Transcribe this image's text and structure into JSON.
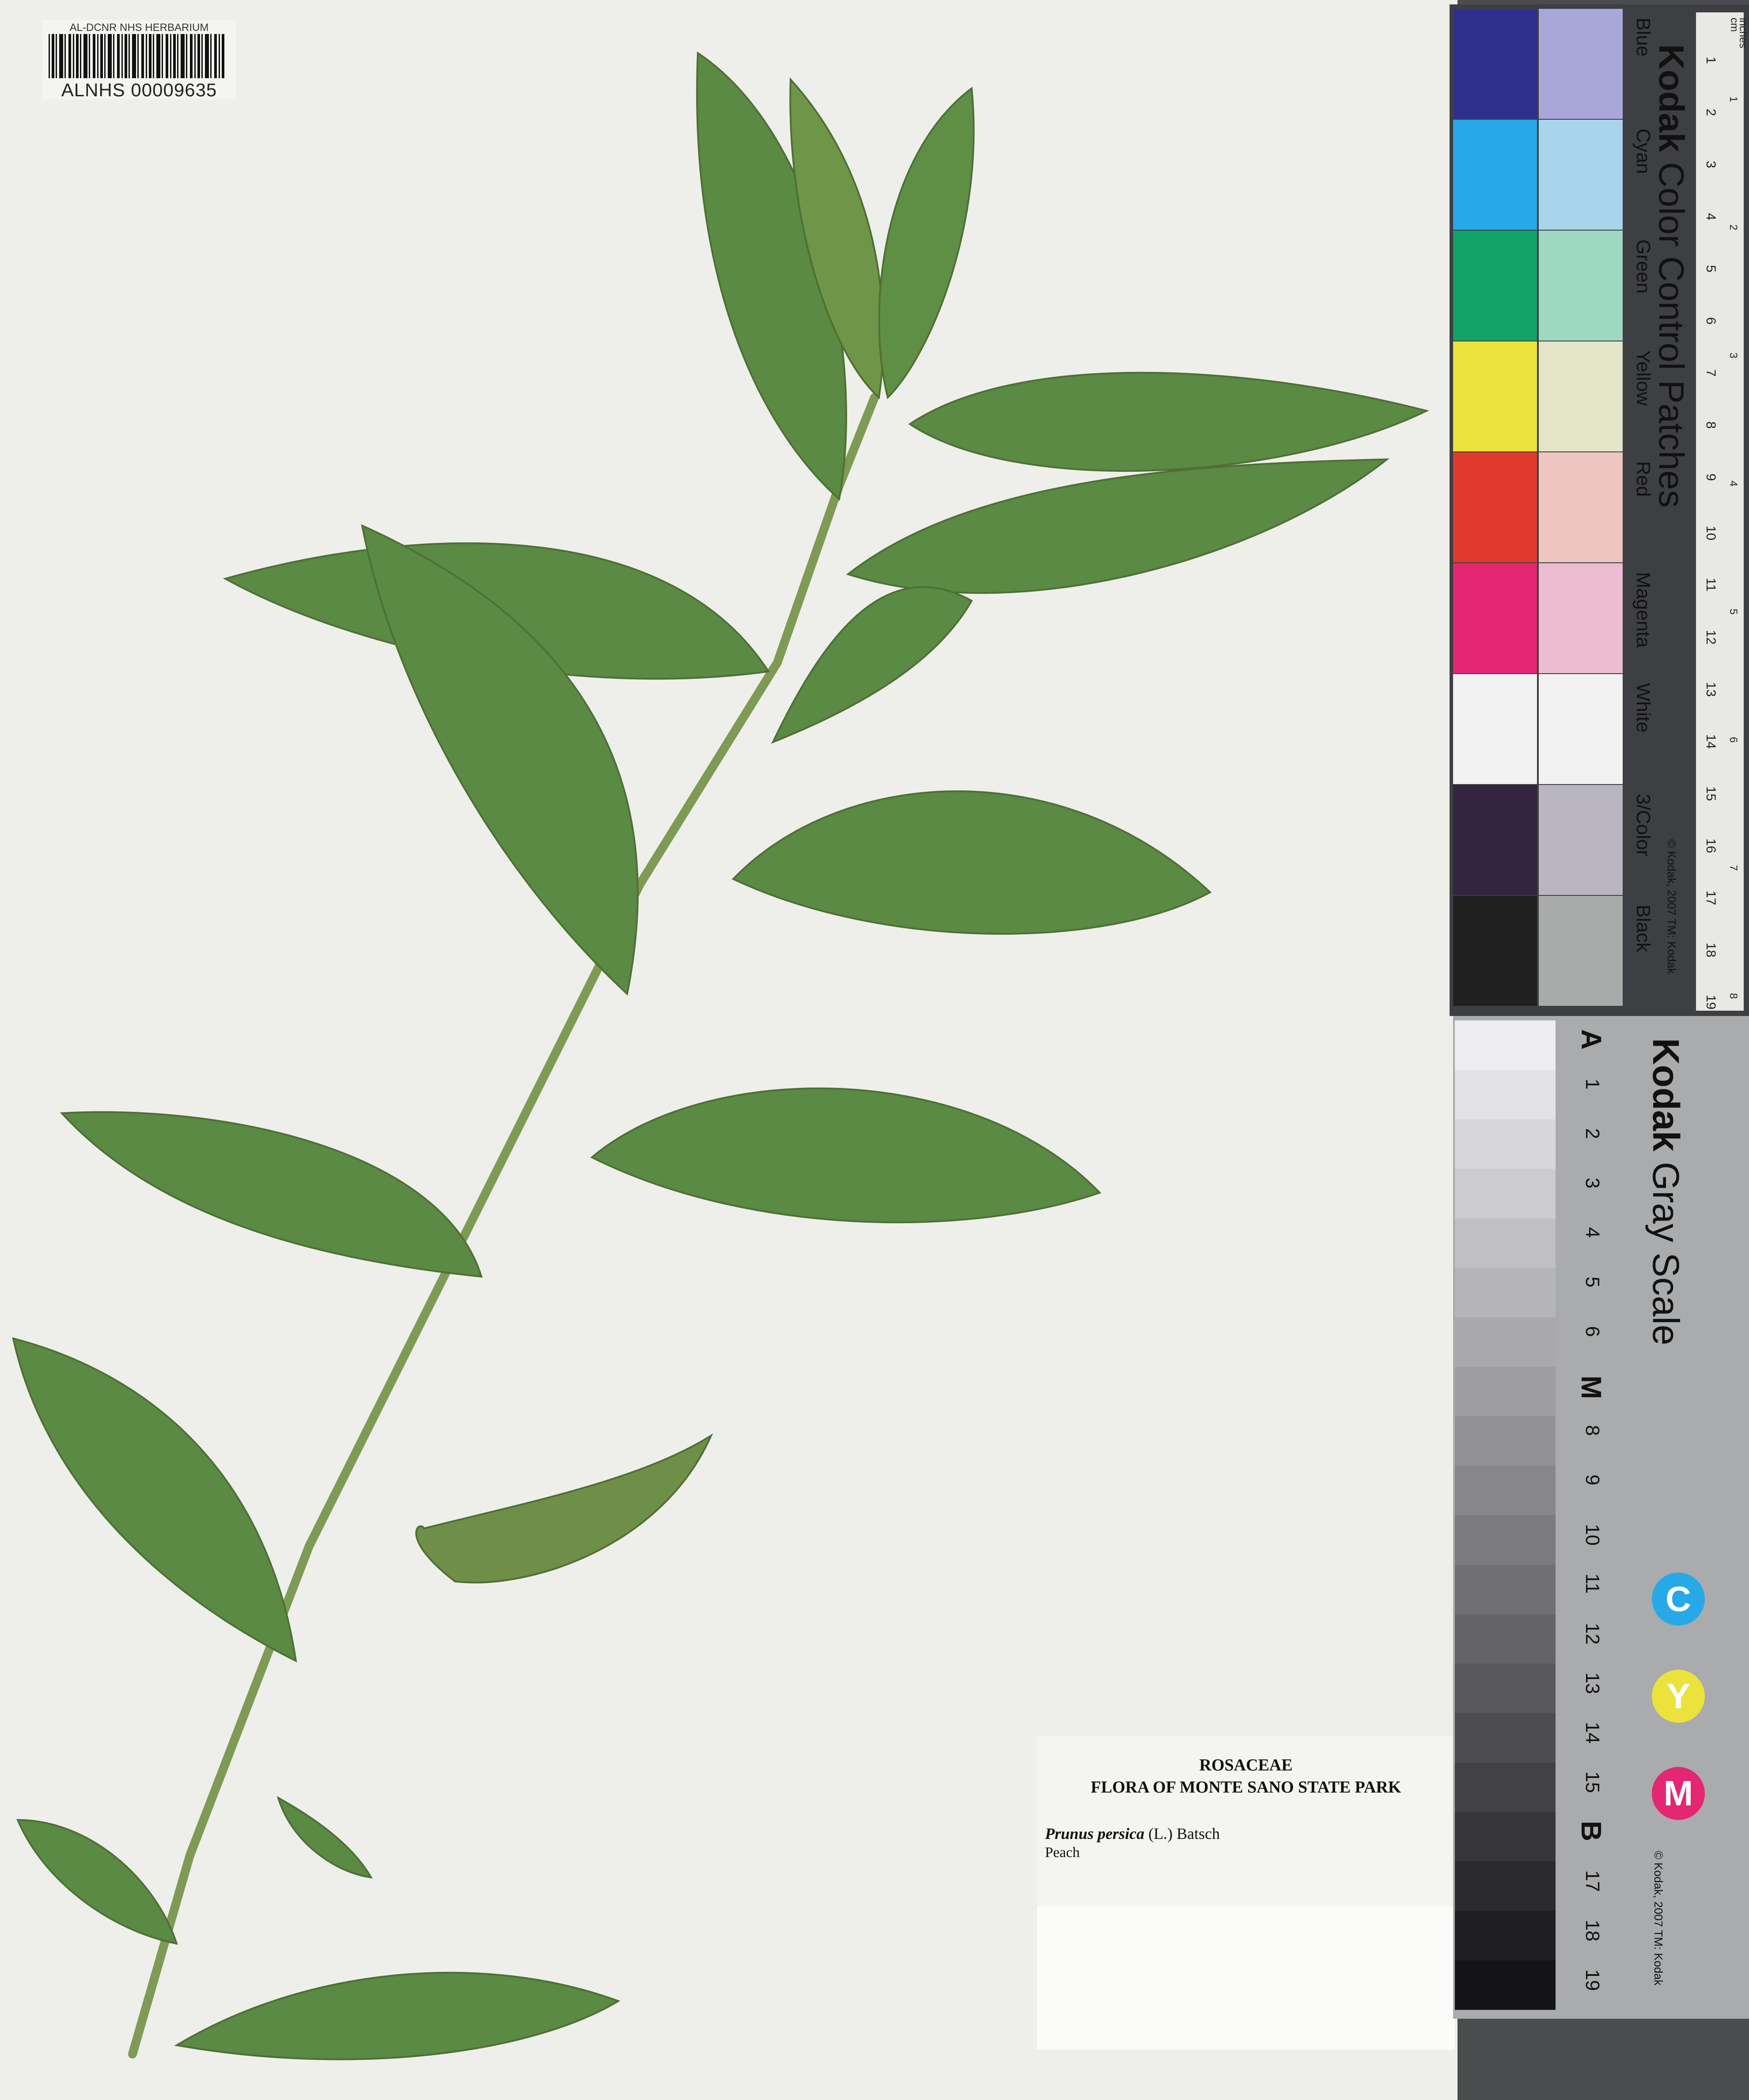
{
  "barcode": {
    "institution": "AL-DCNR NHS HERBARIUM",
    "number": "ALNHS 00009635"
  },
  "label": {
    "family": "ROSACEAE",
    "flora": "FLORA OF MONTE SANO STATE PARK",
    "taxon_genus_species": "Prunus persica",
    "taxon_authority": "(L.) Batsch",
    "common_name": "Peach"
  },
  "color_card": {
    "brand": "Kodak",
    "title": "Color Control Patches",
    "copyright": "© Kodak, 2007 TM: Kodak",
    "ruler_units": [
      "cm",
      "inches"
    ],
    "ruler_cm": [
      "1",
      "2",
      "3",
      "4",
      "5",
      "6",
      "7",
      "8",
      "9",
      "10",
      "11",
      "12",
      "13",
      "14",
      "15",
      "16",
      "17",
      "18",
      "19"
    ],
    "ruler_inches": [
      "1",
      "2",
      "3",
      "4",
      "5",
      "6",
      "7",
      "8"
    ],
    "patches": [
      {
        "label": "Blue",
        "color": "#2f2f8e",
        "tint": "#a9a7da"
      },
      {
        "label": "Cyan",
        "color": "#27a9e8",
        "tint": "#a8d5ec"
      },
      {
        "label": "Green",
        "color": "#14a268",
        "tint": "#9fd8c2"
      },
      {
        "label": "Yellow",
        "color": "#ebe33c",
        "tint": "#e3e4c8"
      },
      {
        "label": "Red",
        "color": "#e03a2f",
        "tint": "#eec5c0"
      },
      {
        "label": "Magenta",
        "color": "#e52673",
        "tint": "#ecbcd1"
      },
      {
        "label": "White",
        "color": "#f2f2f2",
        "tint": "#f2f2f2"
      },
      {
        "label": "3/Color",
        "color": "#33243f",
        "tint": "#b9b6c2"
      },
      {
        "label": "Black",
        "color": "#202020",
        "tint": "#a9aaaa"
      }
    ]
  },
  "gray_card": {
    "brand": "Kodak",
    "title": "Gray Scale",
    "copyright": "© Kodak, 2007 TM: Kodak",
    "steps": [
      "A",
      "1",
      "2",
      "3",
      "4",
      "5",
      "6",
      "M",
      "8",
      "9",
      "10",
      "11",
      "12",
      "13",
      "14",
      "15",
      "B",
      "17",
      "18",
      "19"
    ],
    "cym": [
      {
        "letter": "C",
        "color": "#27a9e8"
      },
      {
        "letter": "Y",
        "color": "#ebe33c"
      },
      {
        "letter": "M",
        "color": "#e52673"
      }
    ]
  }
}
